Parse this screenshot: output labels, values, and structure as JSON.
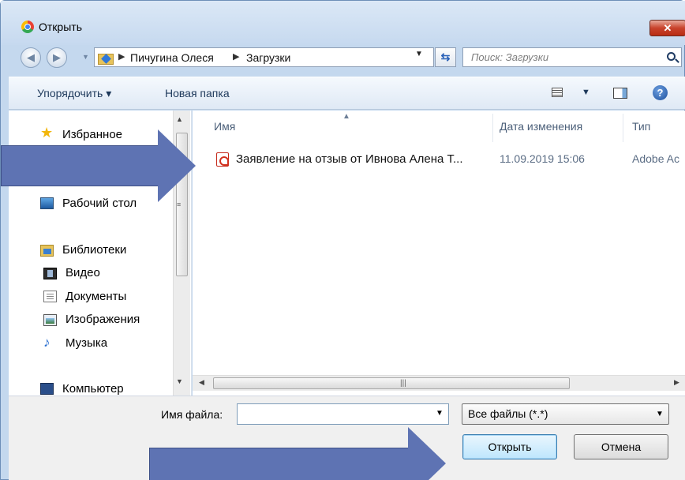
{
  "window": {
    "title": "Открыть",
    "close_label": "✕"
  },
  "navigation": {
    "back_icon": "back-arrow-icon",
    "forward_icon": "forward-arrow-icon"
  },
  "address_bar": {
    "breadcrumbs": [
      "Пичугина Олеся",
      "Загрузки"
    ],
    "separator": "▶"
  },
  "search": {
    "placeholder": "Поиск: Загрузки"
  },
  "toolbar": {
    "organize_label": "Упорядочить ▾",
    "new_folder_label": "Новая папка"
  },
  "sidebar": {
    "items": [
      {
        "label": "Избранное",
        "icon": "star-icon"
      },
      {
        "label": "Рабочий стол",
        "icon": "desktop-icon"
      },
      {
        "label": "Библиотеки",
        "icon": "libraries-icon"
      },
      {
        "label": "Видео",
        "icon": "video-icon"
      },
      {
        "label": "Документы",
        "icon": "documents-icon"
      },
      {
        "label": "Изображения",
        "icon": "images-icon"
      },
      {
        "label": "Музыка",
        "icon": "music-icon"
      },
      {
        "label": "Компьютер",
        "icon": "computer-icon"
      }
    ]
  },
  "file_list": {
    "columns": {
      "name": "Имя",
      "date": "Дата изменения",
      "type": "Тип"
    },
    "rows": [
      {
        "name": "Заявление на отзыв от Ивнова Алена Т...",
        "date": "11.09.2019 15:06",
        "type": "Adobe Ac",
        "icon": "pdf-icon"
      }
    ]
  },
  "footer": {
    "filename_label": "Имя файла:",
    "filename_value": "",
    "filter_value": "Все файлы (*.*)",
    "open_button": "Открыть",
    "cancel_button": "Отмена"
  },
  "annotation": {
    "arrow_color": "#5e73b3"
  }
}
